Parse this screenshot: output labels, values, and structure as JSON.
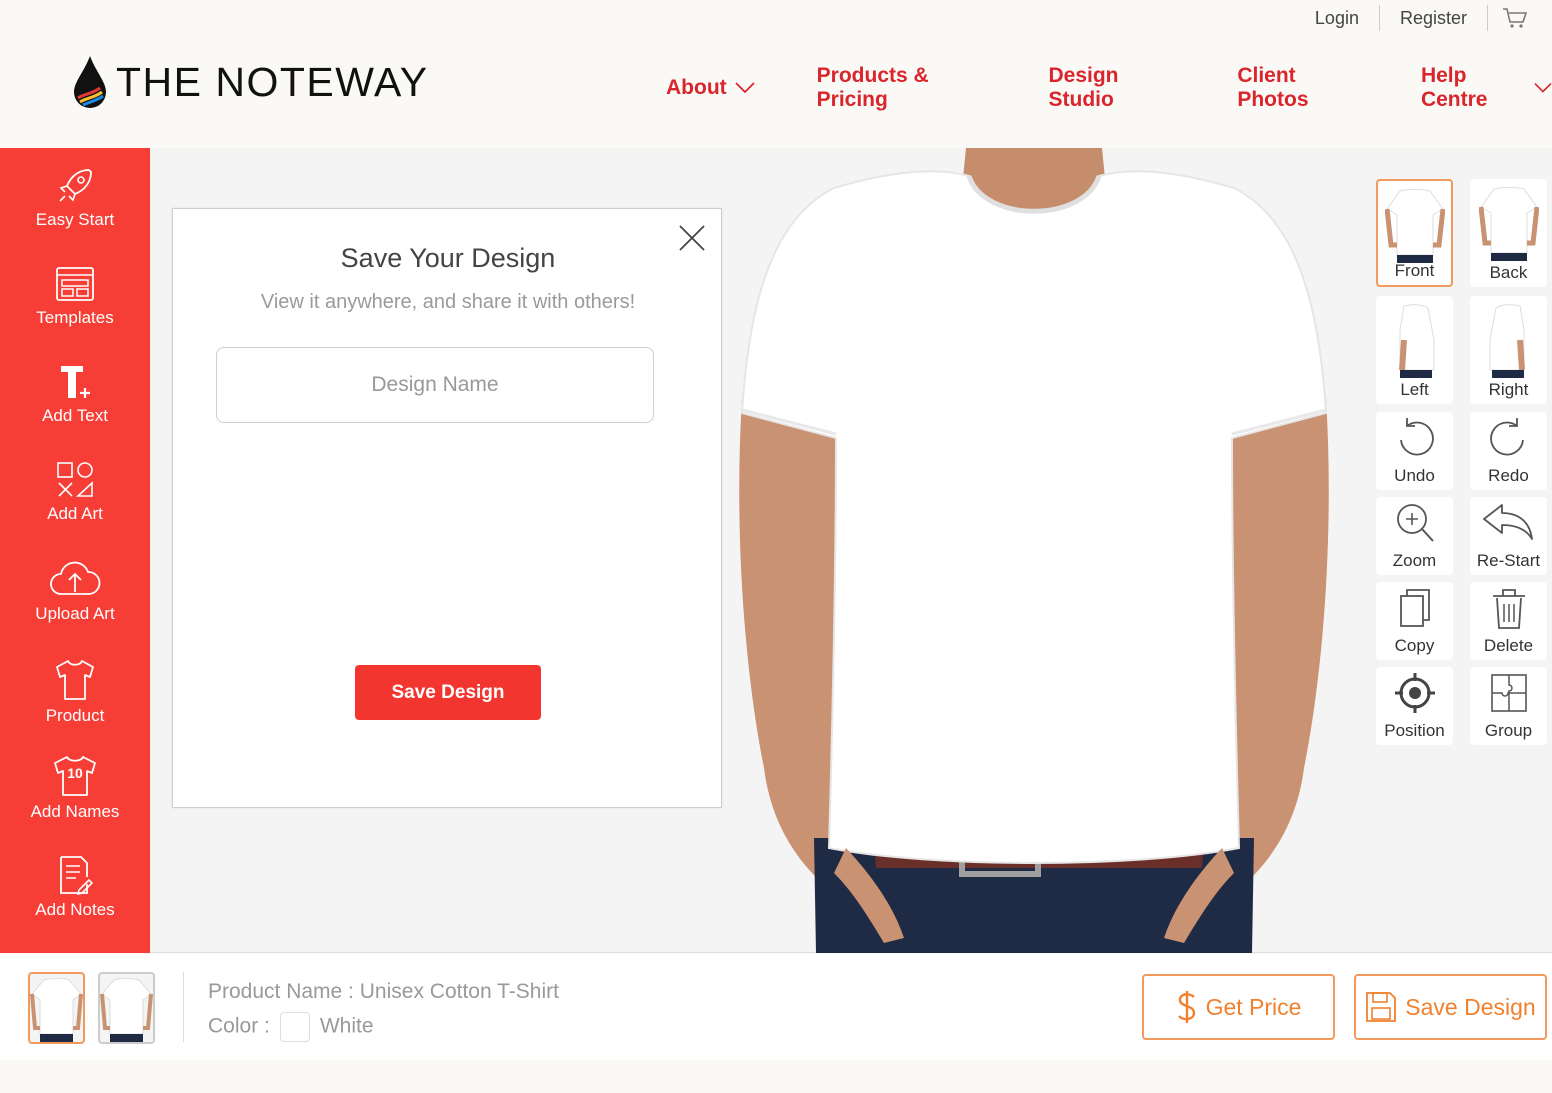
{
  "header": {
    "brand": "THE NOTEWAY",
    "top_links": {
      "login": "Login",
      "register": "Register"
    },
    "nav": [
      "About",
      "Products & Pricing",
      "Design Studio",
      "Client Photos",
      "Help Centre"
    ]
  },
  "left_rail": {
    "items": [
      {
        "label": "Easy Start",
        "icon": "rocket-icon"
      },
      {
        "label": "Templates",
        "icon": "template-icon"
      },
      {
        "label": "Add Text",
        "icon": "text-icon"
      },
      {
        "label": "Add Art",
        "icon": "shapes-icon"
      },
      {
        "label": "Upload Art",
        "icon": "cloud-upload-icon"
      },
      {
        "label": "Product",
        "icon": "tshirt-icon"
      },
      {
        "label": "Add Names",
        "icon": "jersey-number-icon"
      },
      {
        "label": "Add Notes",
        "icon": "notes-icon"
      }
    ]
  },
  "modal": {
    "title": "Save Your Design",
    "subtitle": "View it anywhere, and share it with others!",
    "input_placeholder": "Design Name",
    "input_value": "",
    "save_label": "Save Design"
  },
  "right_tools": {
    "views": [
      "Front",
      "Back",
      "Left",
      "Right"
    ],
    "active_view": "Front",
    "actions": [
      "Undo",
      "Redo",
      "Zoom",
      "Re-Start",
      "Copy",
      "Delete",
      "Position",
      "Group"
    ]
  },
  "bottom": {
    "product_name_label": "Product Name :",
    "product_name": "Unisex Cotton T-Shirt",
    "color_label": "Color :",
    "color_value": "White",
    "get_price": "Get Price",
    "save_design": "Save Design"
  },
  "colors": {
    "accent": "#f63d36",
    "nav": "#d9252c",
    "orange": "#f0812f",
    "orange_border": "#f29a5e"
  }
}
